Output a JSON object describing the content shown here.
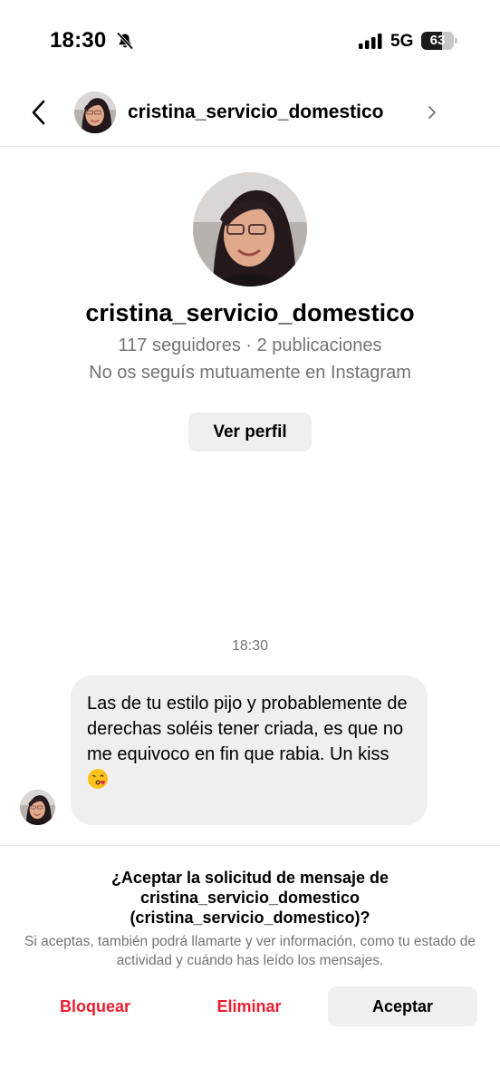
{
  "status_bar": {
    "time": "18:30",
    "network": "5G",
    "battery_percent": "63",
    "battery_level": 0.63,
    "icons": [
      "bell-slash-icon",
      "signal-icon",
      "battery-icon"
    ]
  },
  "header": {
    "username": "cristina_servicio_domestico",
    "icons": [
      "back-chevron-icon",
      "chevron-right-icon"
    ]
  },
  "profile": {
    "username": "cristina_servicio_domestico",
    "stats": "117 seguidores · 2 publicaciones",
    "mutual": "No os seguís mutuamente en Instagram",
    "view_profile_label": "Ver perfil"
  },
  "conversation": {
    "timestamp": "18:30",
    "messages": [
      {
        "text": "Las de tu estilo pijo y probablemente de derechas soléis tener criada, es que no me equivoco en fin que rabia. Un kiss",
        "emoji": "face-blowing-kiss-icon"
      }
    ]
  },
  "request": {
    "title": "¿Aceptar la solicitud de mensaje de cristina_servicio_domestico (cristina_servicio_domestico)?",
    "description": "Si aceptas, también podrá llamarte y ver información, como tu estado de actividad y cuándo has leído los mensajes.",
    "block_label": "Bloquear",
    "delete_label": "Eliminar",
    "accept_label": "Aceptar"
  },
  "colors": {
    "danger": "#ed1c2e",
    "muted_text": "#737373",
    "bubble_bg": "#efefef",
    "button_bg": "#efefef"
  }
}
